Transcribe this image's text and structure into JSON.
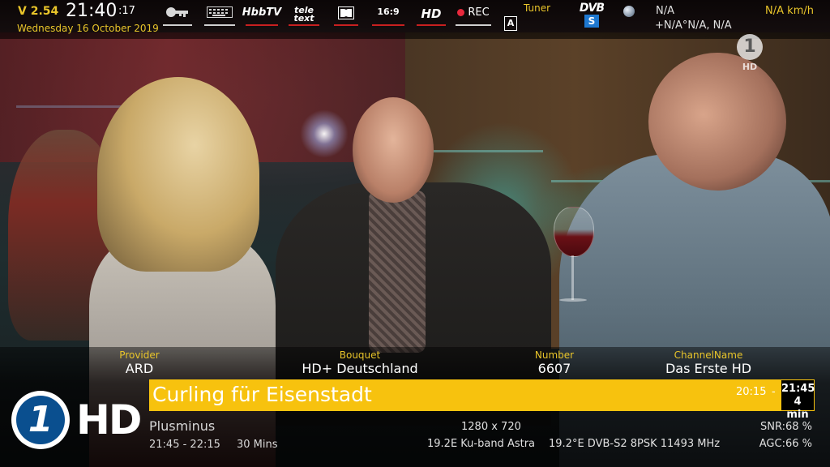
{
  "status": {
    "version": "V 2.54",
    "clock": "21:40",
    "seconds": ":17",
    "date": "Wednesday 16 October 2019"
  },
  "indicators": {
    "key_icon": "key-icon",
    "keyboard_icon": "keyboard-icon",
    "hbbtv": "HbbTV",
    "teletext_1": "tele",
    "teletext_2": "text",
    "dolby_icon": "dolby-icon",
    "aspect": "16:9",
    "hd": "HD",
    "rec": "REC",
    "audio_track": "A",
    "tuner_label": "Tuner",
    "dvb": "DVB",
    "dvb_type": "S"
  },
  "gps": {
    "coords": "N/A",
    "position": "+N/A°N/A, N/A",
    "speed": "N/A km/h"
  },
  "channel_logo_small": {
    "symbol": "1",
    "hd": "HD"
  },
  "service": {
    "provider_label": "Provider",
    "provider": "ARD",
    "bouquet_label": "Bouquet",
    "bouquet": "HD+ Deutschland",
    "number_label": "Number",
    "number": "6607",
    "channel_label": "ChannelName",
    "channel": "Das Erste HD"
  },
  "now": {
    "title": "Curling für Eisenstadt",
    "start": "20:15",
    "dash": "-",
    "end": "21:45",
    "remaining": "4 min"
  },
  "next": {
    "title": "Plusminus",
    "time": "21:45  -  22:15",
    "duration": "30 Mins"
  },
  "signal": {
    "resolution": "1280 x 720",
    "satellite": "19.2E Ku-band Astra",
    "transponder": "19.2°E DVB-S2 8PSK 11493 MHz",
    "snr": "SNR:68 %",
    "agc": "AGC:66 %"
  },
  "logo_big": {
    "symbol": "1",
    "hd": "HD"
  },
  "colors": {
    "accent": "#f7c20e",
    "label": "#e9c52a",
    "underline": "#c82020",
    "rec": "#e8283c",
    "dvb_s": "#1e78d0"
  }
}
